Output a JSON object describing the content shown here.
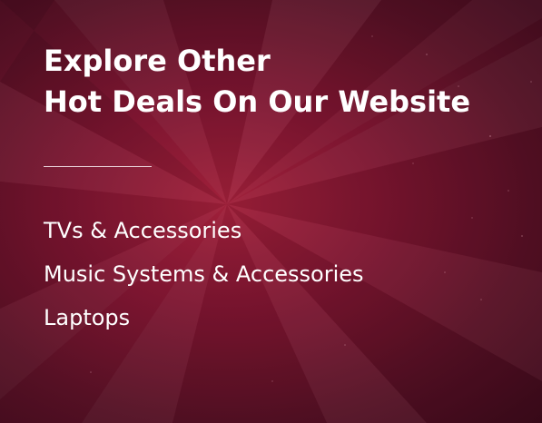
{
  "heading": {
    "line1": "Explore Other",
    "line2": "Hot Deals On Our Website"
  },
  "links": [
    {
      "label": "TVs & Accessories"
    },
    {
      "label": "Music Systems & Accessories"
    },
    {
      "label": "Laptops"
    }
  ],
  "colors": {
    "background": "#7c1530",
    "text": "#ffffff",
    "divider": "#e9d3da"
  }
}
